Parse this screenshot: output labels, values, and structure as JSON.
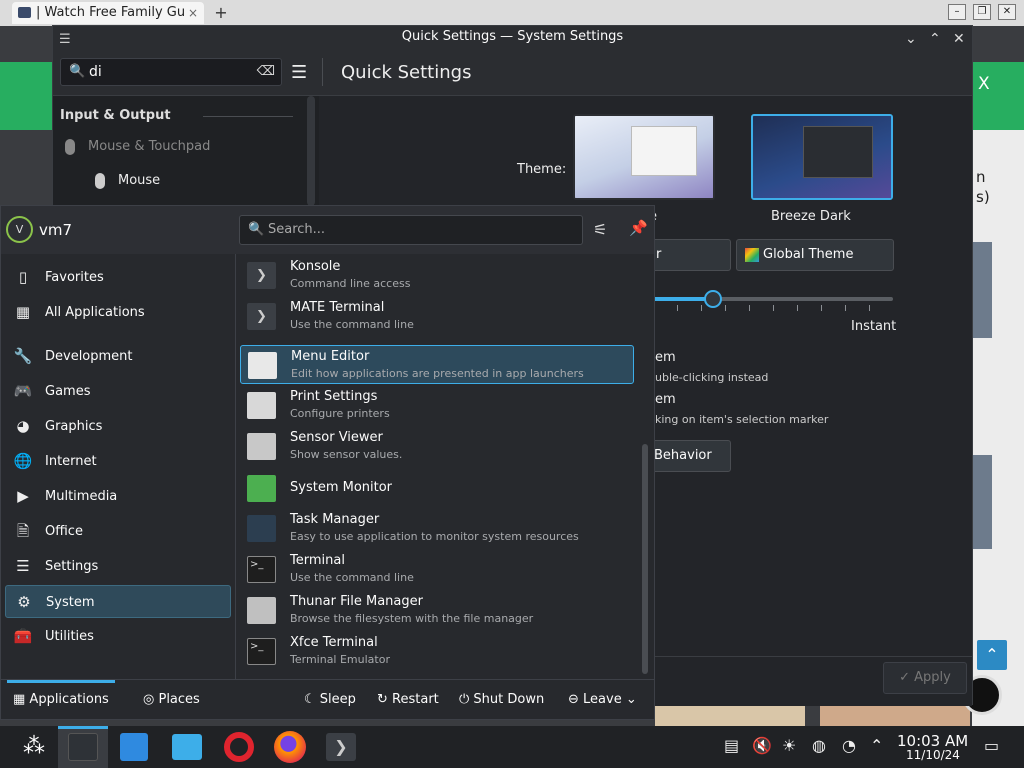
{
  "browser": {
    "tab_title": "| Watch Free Family Gu",
    "tab_close": "×",
    "new_tab": "+",
    "btn_min": "–",
    "btn_max": "❐",
    "btn_close": "✕"
  },
  "webpage": {
    "close_glyph": "X",
    "side_text_1": "n",
    "side_text_2": "s)",
    "scroll_top_glyph": "⌃"
  },
  "settings_window": {
    "title": "Quick Settings — System Settings",
    "search_value": "di",
    "page_title": "Quick Settings",
    "sidebar": {
      "heading": "Input & Output",
      "items": [
        "Mouse & Touchpad",
        "Mouse"
      ]
    },
    "theme_label": "Theme:",
    "theme_cards": [
      {
        "name": "e",
        "colors": {
          "bg": "#c9d3e6"
        }
      },
      {
        "name": "Breeze Dark",
        "colors": {
          "bg": "#2a3e6b"
        }
      }
    ],
    "buttons": {
      "partial_left": "r",
      "global_theme": "Global Theme",
      "behavior": "Behavior",
      "apply": "Apply"
    },
    "animation_speed_label": "Instant",
    "animation_slider_value": 0.25,
    "click_behavior": [
      {
        "title": "em",
        "desc": "uble-clicking instead"
      },
      {
        "title": "em",
        "desc": "king on item's selection marker"
      }
    ]
  },
  "launcher": {
    "username": "vm7",
    "avatar_letter": "V",
    "search_placeholder": "Search...",
    "cut_text": "...",
    "categories": [
      {
        "label": "Favorites",
        "icon": "bookmark-icon",
        "glyph": "▯"
      },
      {
        "label": "All Applications",
        "icon": "grid-icon",
        "glyph": "▦"
      },
      {
        "label": "Development",
        "icon": "wrench-icon",
        "glyph": "🔧"
      },
      {
        "label": "Games",
        "icon": "gamepad-icon",
        "glyph": "🎮"
      },
      {
        "label": "Graphics",
        "icon": "palette-icon",
        "glyph": "◕"
      },
      {
        "label": "Internet",
        "icon": "globe-icon",
        "glyph": "🌐"
      },
      {
        "label": "Multimedia",
        "icon": "media-icon",
        "glyph": "▶"
      },
      {
        "label": "Office",
        "icon": "document-icon",
        "glyph": "🗎"
      },
      {
        "label": "Settings",
        "icon": "sliders-icon",
        "glyph": "☰"
      },
      {
        "label": "System",
        "icon": "gear-icon",
        "glyph": "⚙"
      },
      {
        "label": "Utilities",
        "icon": "toolbox-icon",
        "glyph": "🧰"
      }
    ],
    "selected_category": "System",
    "apps": [
      {
        "name": "Konsole",
        "desc": "Command line access",
        "icon": "terminal-chevron-icon",
        "color": "#3b3f45"
      },
      {
        "name": "MATE Terminal",
        "desc": "Use the command line",
        "icon": "terminal-chevron-icon",
        "color": "#3b3f45"
      },
      {
        "name": "Menu Editor",
        "desc": "Edit how applications are presented in app launchers",
        "icon": "menu-editor-icon",
        "color": "#e8e8e8"
      },
      {
        "name": "Print Settings",
        "desc": "Configure printers",
        "icon": "printer-icon",
        "color": "#d8d8d8"
      },
      {
        "name": "Sensor Viewer",
        "desc": "Show sensor values.",
        "icon": "sensor-icon",
        "color": "#c8c8c8"
      },
      {
        "name": "System Monitor",
        "desc": "",
        "icon": "system-monitor-icon",
        "color": "#4caf50"
      },
      {
        "name": "Task Manager",
        "desc": "Easy to use application to monitor system resources",
        "icon": "task-manager-icon",
        "color": "#2c3e50"
      },
      {
        "name": "Terminal",
        "desc": "Use the command line",
        "icon": "terminal-icon",
        "color": "#1e1e1e"
      },
      {
        "name": "Thunar File Manager",
        "desc": "Browse the filesystem with the file manager",
        "icon": "file-manager-icon",
        "color": "#c0c0c0"
      },
      {
        "name": "Xfce Terminal",
        "desc": "Terminal Emulator",
        "icon": "terminal-icon",
        "color": "#1e1e1e"
      }
    ],
    "selected_app": "Menu Editor",
    "bottom": {
      "applications": "Applications",
      "places": "Places",
      "sleep": "Sleep",
      "restart": "Restart",
      "shut_down": "Shut Down",
      "leave": "Leave"
    }
  },
  "taskbar": {
    "clock_time": "10:03 AM",
    "clock_date": "11/10/24"
  },
  "colors": {
    "accent": "#3daee9",
    "selection": "#2d4a5c",
    "panel": "#27292d"
  }
}
